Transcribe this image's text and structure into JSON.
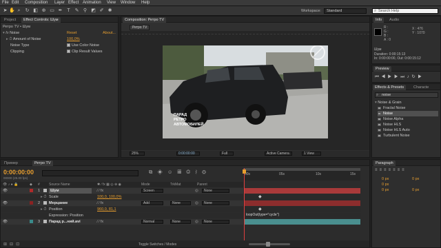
{
  "menu": [
    "File",
    "Edit",
    "Composition",
    "Layer",
    "Effect",
    "Animation",
    "View",
    "Window",
    "Help"
  ],
  "toolbar": {
    "workspace_label": "Workspace:",
    "workspace_value": "Standard",
    "search_placeholder": "Search Help"
  },
  "left_panel": {
    "tabs": [
      "Project",
      "Effect Controls: Шум"
    ],
    "breadcrumb": "Ретро TV • Шум",
    "effect_name": "Noise",
    "reset": "Reset",
    "about": "About...",
    "amount_label": "Amount of Noise",
    "amount_value": "100,0%",
    "type_label": "Noise Type",
    "type_option": "Use Color Noise",
    "clip_label": "Clipping",
    "clip_option": "Clip Result Values"
  },
  "comp_panel": {
    "tab": "Composition: Ретро TV",
    "subtab": "Ретро TV",
    "caption": [
      "ПАРАД",
      "РЕТРО",
      "АВТОМОБИЛЕЙ"
    ],
    "zoom": "25%",
    "time": "0:00:00:00",
    "res": "Full",
    "camera": "Active Camera",
    "view": "1 View"
  },
  "info_panel": {
    "tabs": [
      "Info",
      "Audio"
    ],
    "r": "R :",
    "g": "G :",
    "b": "B :",
    "a": "A : 0",
    "x": "X : 476",
    "y": "Y : 1070",
    "name": "Шум",
    "duration": "Duration: 0:00:15:13",
    "inout": "In: 0:00:00:00, Out: 0:00:15:12"
  },
  "preview_panel": {
    "tab": "Preview"
  },
  "effects_panel": {
    "tabs": [
      "Effects & Presets",
      "Characte"
    ],
    "search": "noise",
    "folder": "Noise & Grain",
    "items": [
      "Fractal Noise",
      "Noise",
      "Noise Alpha",
      "Noise HLS",
      "Noise HLS Auto",
      "Turbulent Noise"
    ],
    "selected_index": 1
  },
  "timeline": {
    "tabs": [
      "Пример",
      "Ретро TV"
    ],
    "timecode": "0:00:00:00",
    "fps": "00000 (25.00 fps)",
    "col_source": "Source Name",
    "col_mode": "Mode",
    "col_trkmat": "TrkMat",
    "col_parent": "Parent",
    "ruler": [
      "00s",
      "05s",
      "10s",
      "15s"
    ],
    "layers": [
      {
        "num": "1",
        "name": "Шум",
        "mode": "Screen",
        "trkmat": "",
        "parent": "None",
        "color": "#b02a2a",
        "bar": "#a93a3a"
      },
      {
        "num": "",
        "name": "Scale",
        "value": "100,0, 100,0%",
        "sub": true
      },
      {
        "num": "2",
        "name": "Мерцание",
        "mode": "Add",
        "trkmat": "None",
        "parent": "None",
        "color": "#8a2222",
        "bar": "#8c2d2d"
      },
      {
        "num": "",
        "name": "Position",
        "value": "960,0, 81,1",
        "sub": true
      },
      {
        "num": "",
        "name": "Expression: Position",
        "sub": true,
        "expression": "loopOut(type=\"cycle\")"
      },
      {
        "num": "3",
        "name": "Парад р...ний.avi",
        "mode": "Normal",
        "trkmat": "None",
        "parent": "None",
        "color": "#3a8a8a",
        "bar": "#4a8f8f"
      }
    ],
    "toggle_label": "Toggle Switches / Modes"
  },
  "paragraph_panel": {
    "tab": "Paragraph",
    "px_values": [
      "0 px",
      "0 px",
      "0 px",
      "0 px",
      "0 px"
    ]
  }
}
